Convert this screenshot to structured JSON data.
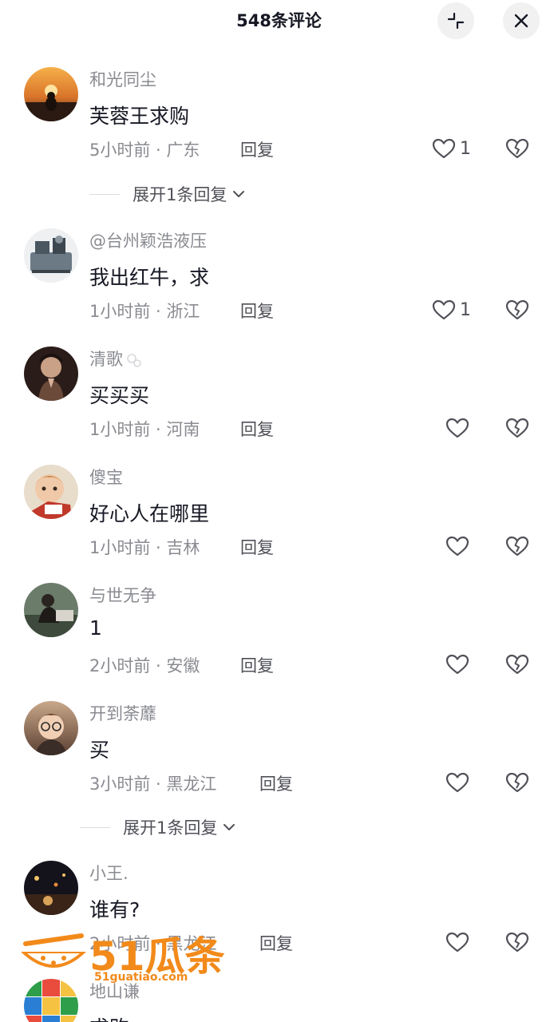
{
  "header": {
    "title": "548条评论"
  },
  "colors": {
    "text": "#161823",
    "meta": "#8a8b91",
    "reply": "#505158",
    "button_bg": "#f1f1f2",
    "watermark": "#f28a1a"
  },
  "comments": [
    {
      "user": "和光同尘",
      "text": "芙蓉王求购",
      "time": "5小时前",
      "location": "广东",
      "reply": "回复",
      "likes": "1"
    },
    {
      "user": "@台州颖浩液压",
      "text": "我出红牛，求",
      "time": "1小时前",
      "location": "浙江",
      "reply": "回复",
      "likes": "1"
    },
    {
      "user": "清歌",
      "text": "买买买",
      "time": "1小时前",
      "location": "河南",
      "reply": "回复",
      "likes": ""
    },
    {
      "user": "傻宝",
      "text": "好心人在哪里",
      "time": "1小时前",
      "location": "吉林",
      "reply": "回复",
      "likes": ""
    },
    {
      "user": "与世无争",
      "text": "1",
      "time": "2小时前",
      "location": "安徽",
      "reply": "回复",
      "likes": ""
    },
    {
      "user": "开到荼蘼",
      "text": "买",
      "time": "3小时前",
      "location": "黑龙江",
      "reply": "回复",
      "likes": ""
    },
    {
      "user": "小王.",
      "text": "谁有?",
      "time": "2小时前",
      "location": "黑龙江",
      "reply": "回复",
      "likes": ""
    },
    {
      "user": "地山谦",
      "text": "求购",
      "time": "",
      "location": "",
      "reply": "",
      "likes": ""
    }
  ],
  "expand_replies": [
    {
      "label": "展开1条回复"
    },
    {
      "label": "展开1条回复"
    }
  ],
  "watermark": {
    "brand": "51瓜条",
    "url": "51guatiao.com"
  },
  "icons": [
    "collapse-icon",
    "close-icon",
    "heart-icon",
    "heart-broken-icon",
    "chevron-down-icon"
  ]
}
